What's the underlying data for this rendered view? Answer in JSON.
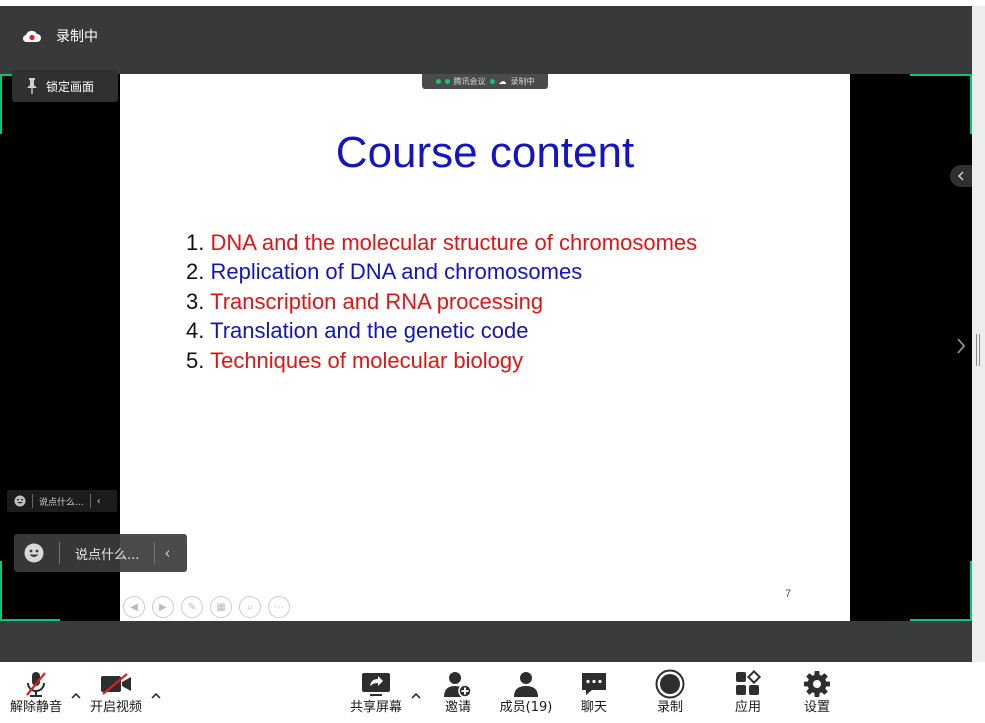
{
  "recording_status": "录制中",
  "lock_screen_label": "锁定画面",
  "meeting_tag": {
    "app_name": "腾讯会议",
    "recording": "录制中"
  },
  "slide": {
    "title": "Course content",
    "items": [
      {
        "number": "1.",
        "text": "DNA and the molecular structure of chromosomes",
        "color": "#e01414"
      },
      {
        "number": "2.",
        "text": "Replication of DNA and chromosomes",
        "color": "#1414c0"
      },
      {
        "number": "3.",
        "text": "Transcription and RNA processing",
        "color": "#e01414"
      },
      {
        "number": "4.",
        "text": "Translation and the genetic code",
        "color": "#1414c0"
      },
      {
        "number": "5.",
        "text": "Techniques of molecular biology",
        "color": "#e01414"
      }
    ],
    "page_number": "7"
  },
  "chat_placeholder_small": "说点什么...",
  "chat_placeholder": "说点什么...",
  "toolbar": {
    "unmute": "解除静音",
    "start_video": "开启视频",
    "share_screen": "共享屏幕",
    "invite": "邀请",
    "members": "成员(19)",
    "chat": "聊天",
    "record": "录制",
    "apps": "应用",
    "settings": "设置"
  },
  "colors": {
    "accent_green": "#13c27a",
    "bar_dark": "#38393b",
    "mute_red": "#e02020"
  }
}
